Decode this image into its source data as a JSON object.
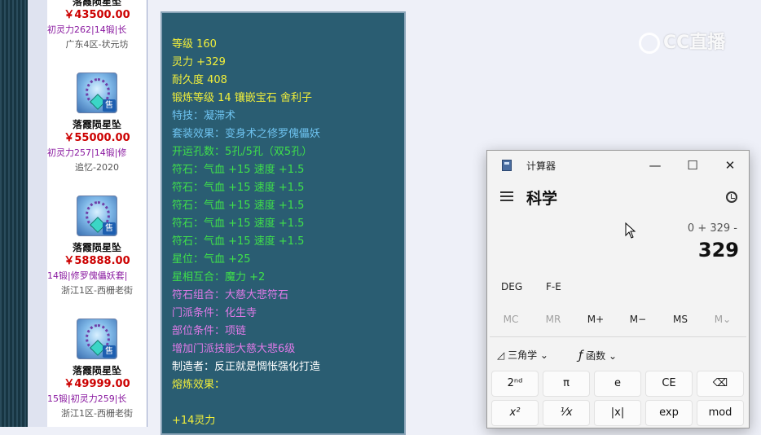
{
  "listings": [
    {
      "name": "落霞陨星坠",
      "price": "￥43500.00",
      "attrs": "初灵力262|14锻|长",
      "server": "广东4区-状元坊"
    },
    {
      "name": "落霞陨星坠",
      "price": "￥55000.00",
      "attrs": "初灵力257|14锻|修",
      "server": "追忆-2020"
    },
    {
      "name": "落霞陨星坠",
      "price": "￥58888.00",
      "attrs": "14锻|修罗傀儡妖套|",
      "server": "浙江1区-西栅老街"
    },
    {
      "name": "落霞陨星坠",
      "price": "￥49999.00",
      "attrs": "15锻|初灵力259|长",
      "server": "浙江1区-西栅老街"
    }
  ],
  "sell_badge": "售",
  "tooltip": {
    "lines": [
      {
        "text": "等级 160",
        "color": "#f2ef3a"
      },
      {
        "text": "灵力 +329",
        "color": "#f2ef3a"
      },
      {
        "text": "耐久度 408",
        "color": "#f2ef3a"
      },
      {
        "text": "锻炼等级 14 镶嵌宝石 舍利子",
        "color": "#f2ef3a"
      },
      {
        "text": "特技：凝滞术",
        "color": "#6ec3f0"
      },
      {
        "text": "套装效果：变身术之修罗傀儡妖",
        "color": "#6ec3f0"
      },
      {
        "text": "开运孔数：5孔/5孔（双5孔）",
        "color": "#3fe04a"
      },
      {
        "text": "符石：气血 +15 速度 +1.5",
        "color": "#3fe04a"
      },
      {
        "text": "符石：气血 +15 速度 +1.5",
        "color": "#3fe04a"
      },
      {
        "text": "符石：气血 +15 速度 +1.5",
        "color": "#3fe04a"
      },
      {
        "text": "符石：气血 +15 速度 +1.5",
        "color": "#3fe04a"
      },
      {
        "text": "符石：气血 +15 速度 +1.5",
        "color": "#3fe04a"
      },
      {
        "text": "星位：气血 +25",
        "color": "#3fe04a"
      },
      {
        "text": "星相互合：魔力 +2",
        "color": "#3fe04a"
      },
      {
        "text": "符石组合：大慈大悲符石",
        "color": "#e07ae8"
      },
      {
        "text": "门派条件：化生寺",
        "color": "#e07ae8"
      },
      {
        "text": "部位条件：项链",
        "color": "#e07ae8"
      },
      {
        "text": "增加门派技能大慈大悲6级",
        "color": "#e07ae8"
      },
      {
        "text": "制造者：反正就是惆怅强化打造",
        "color": "#ffffff"
      },
      {
        "text": "熔炼效果：",
        "color": "#f2ef3a"
      },
      {
        "text": "",
        "color": "#f2ef3a"
      },
      {
        "text": "+14灵力",
        "color": "#f2ef3a"
      }
    ]
  },
  "watermark": {
    "text": "CC直播"
  },
  "calculator": {
    "window_title": "计算器",
    "minimize": "—",
    "maximize": "☐",
    "close": "✕",
    "mode": "科学",
    "expression": "0 + 329 -",
    "display": "329",
    "toolbar": {
      "deg": "DEG",
      "fe": "F-E"
    },
    "memory": [
      "MC",
      "MR",
      "M+",
      "M−",
      "MS",
      "M⌄"
    ],
    "memory_enabled": [
      false,
      false,
      true,
      true,
      true,
      false
    ],
    "func": {
      "trig": "三角学",
      "trig_icon": "◿",
      "funcs": "函数",
      "funcs_icon": "ƒ",
      "chevron": "⌄"
    },
    "keys_row1": [
      "2ⁿᵈ",
      "π",
      "e",
      "CE",
      "⌫"
    ],
    "keys_row2": [
      "x²",
      "¹⁄x",
      "|x|",
      "exp",
      "mod"
    ]
  }
}
